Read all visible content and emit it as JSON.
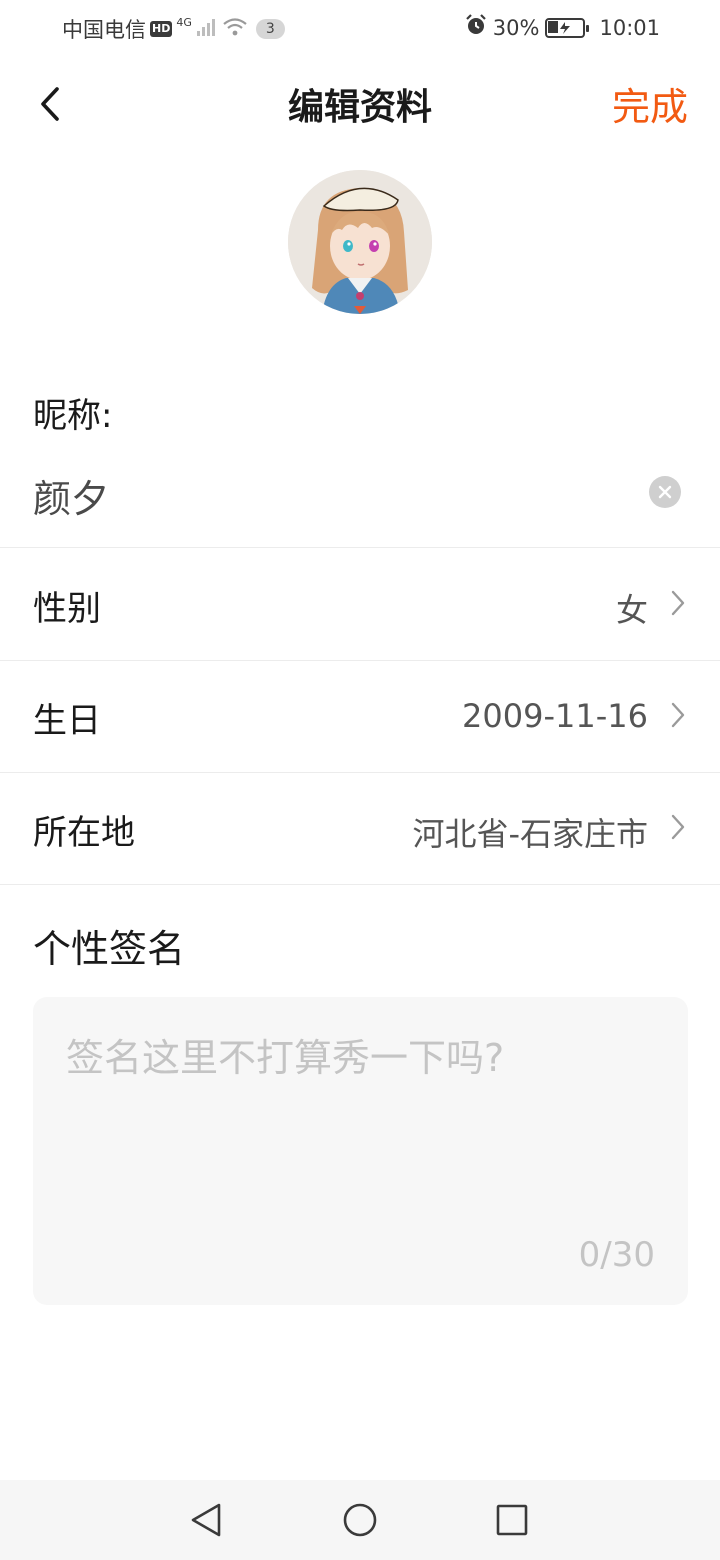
{
  "status_bar": {
    "carrier": "中国电信",
    "hd": "HD",
    "network": "4G",
    "notification_count": "3",
    "battery": "30%",
    "time": "10:01",
    "icons": [
      "signal-icon",
      "wifi-icon",
      "alarm-icon",
      "battery-charging-icon"
    ]
  },
  "header": {
    "title": "编辑资料",
    "done_label": "完成",
    "back_icon": "chevron-left-icon"
  },
  "colors": {
    "accent": "#f25a12",
    "text_primary": "#1a1a1a",
    "text_secondary": "#555555",
    "placeholder": "#c4c4c4",
    "divider": "#ececec",
    "input_bg": "#f7f7f7"
  },
  "profile": {
    "nickname_label": "昵称:",
    "nickname": "颜夕",
    "rows": [
      {
        "label": "性别",
        "value": "女"
      },
      {
        "label": "生日",
        "value": "2009-11-16"
      },
      {
        "label": "所在地",
        "value": "河北省-石家庄市"
      }
    ],
    "signature_label": "个性签名",
    "signature_placeholder": "签名这里不打算秀一下吗?",
    "signature_count": "0/30"
  },
  "nav_bar": {
    "icons": [
      "back-triangle-icon",
      "home-circle-icon",
      "recents-square-icon"
    ]
  }
}
